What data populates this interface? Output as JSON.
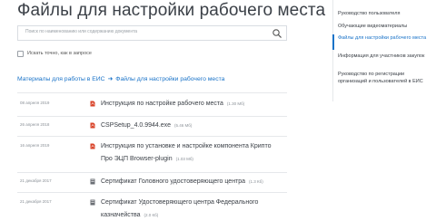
{
  "page": {
    "title": "Файлы для настройки рабочего места"
  },
  "search": {
    "placeholder": "Поиск по наименованию или содержанию документа"
  },
  "exact_search": {
    "label": "Искать точно, как в запросе"
  },
  "breadcrumb": {
    "parent": "Материалы для работы в ЕИС",
    "separator": "➜",
    "current": "Файлы для настройки рабочего места"
  },
  "files": [
    {
      "date": "08 апреля 2019",
      "name": "Инструкция по настройке рабочего места",
      "size": "(1.30 Мб)",
      "icon": "pdf-icon"
    },
    {
      "date": "26 апреля 2018",
      "name": "CSPSetup_4.0.9944.exe",
      "size": "(5.46 Мб)",
      "icon": "pdf-icon"
    },
    {
      "date": "16 апреля 2019",
      "name": "Инструкция по установке и настройке компонента Крипто Про ЭЦП Browser-plugin",
      "size": "(1.03 Мб)",
      "icon": "pdf-icon"
    },
    {
      "date": "21 декабря 2017",
      "name": "Сертификат Головного удостоверяющего центра",
      "size": "(1.3 Кб)",
      "icon": "certificate-icon"
    },
    {
      "date": "21 декабря 2017",
      "name": "Сертификат Удостоверяющего центра Федерального казначейства",
      "size": "(2.0 Кб)",
      "icon": "certificate-icon"
    }
  ],
  "sidebar": {
    "items": [
      {
        "label": "Руководство пользователя",
        "active": false
      },
      {
        "label": "Обучающие видеоматериалы",
        "active": false
      },
      {
        "label": "Файлы для настройки рабочего места",
        "active": true
      },
      {
        "label": "Информация для участников закупок",
        "active": false
      },
      {
        "label": "Руководство по регистрации организаций и пользователей в ЕИС",
        "active": false
      }
    ]
  },
  "colors": {
    "accent": "#1a73c8",
    "pdf_icon": "#d9452b",
    "certificate_icon": "#6b6f75",
    "text": "#3b4047",
    "muted": "#8a9097"
  }
}
